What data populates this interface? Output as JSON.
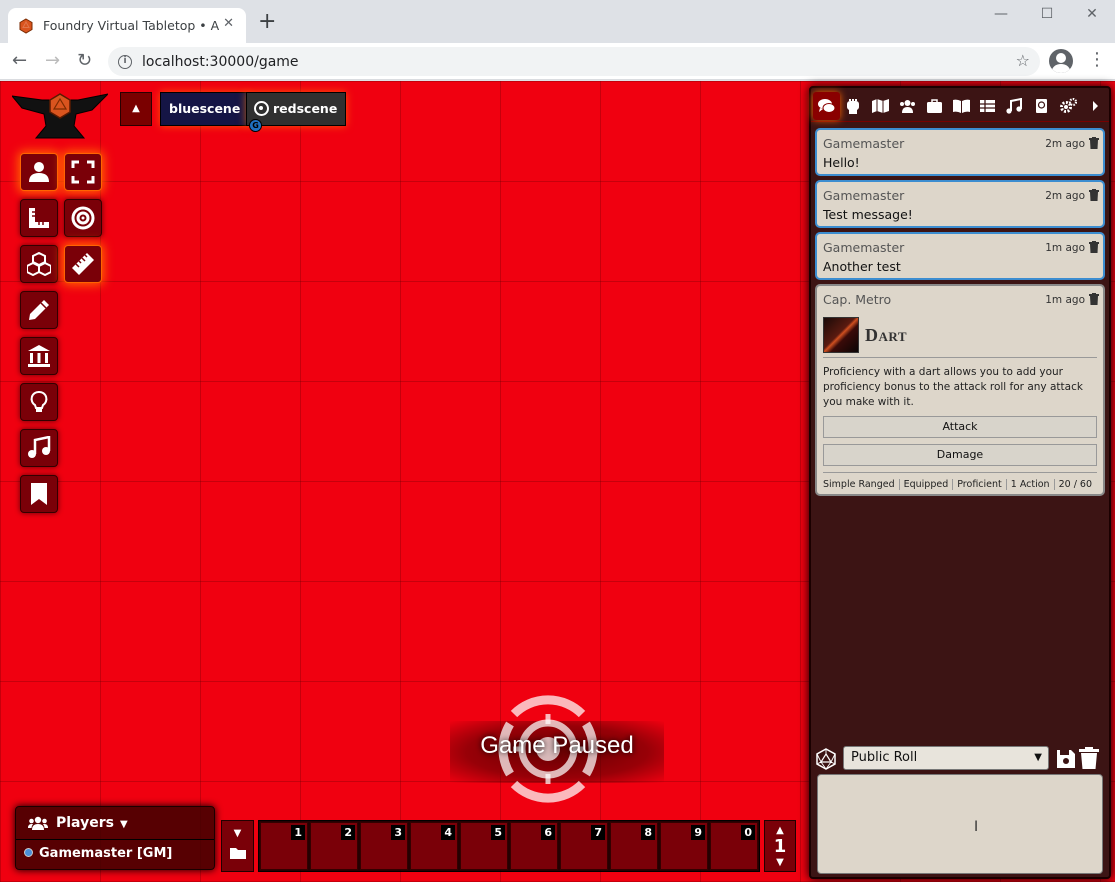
{
  "browser": {
    "tab_title": "Foundry Virtual Tabletop • A Standalone Experience",
    "url": "localhost:30000/game",
    "new_tab": "+",
    "minimize": "—",
    "maximize": "☐",
    "close": "✕"
  },
  "scenes": {
    "toggle": "▲",
    "items": [
      {
        "label": "bluescene"
      },
      {
        "label": "redscene",
        "user_initial": "G"
      }
    ]
  },
  "controls": [
    "token",
    "fullscreen",
    "measure",
    "target",
    "tiles",
    "ruler",
    "draw",
    "walls",
    "lighting",
    "sounds",
    "notes"
  ],
  "pause": {
    "text": "Game Paused"
  },
  "players": {
    "title": "Players",
    "list": [
      {
        "name": "Gamemaster [GM]"
      }
    ]
  },
  "hotbar": {
    "slots": [
      "1",
      "2",
      "3",
      "4",
      "5",
      "6",
      "7",
      "8",
      "9",
      "0"
    ],
    "page": "1"
  },
  "sidebar": {
    "tabs": [
      "chat",
      "combat",
      "scenes",
      "actors",
      "items",
      "journal",
      "tables",
      "playlists",
      "compendium",
      "settings",
      "collapse"
    ],
    "messages": [
      {
        "sender": "Gamemaster",
        "time": "2m ago",
        "text": "Hello!"
      },
      {
        "sender": "Gamemaster",
        "time": "2m ago",
        "text": "Test message!"
      },
      {
        "sender": "Gamemaster",
        "time": "1m ago",
        "text": "Another test"
      }
    ],
    "item_card": {
      "sender": "Cap. Metro",
      "time": "1m ago",
      "name": "Dart",
      "description": "Proficiency with a dart allows you to add your proficiency bonus to the attack roll for any attack you make with it.",
      "attack_label": "Attack",
      "damage_label": "Damage",
      "properties": [
        "Simple Ranged",
        "Equipped",
        "Proficient",
        "1 Action",
        "20 / 60"
      ]
    },
    "roll_mode": "Public Roll",
    "chat_input_value": ""
  }
}
